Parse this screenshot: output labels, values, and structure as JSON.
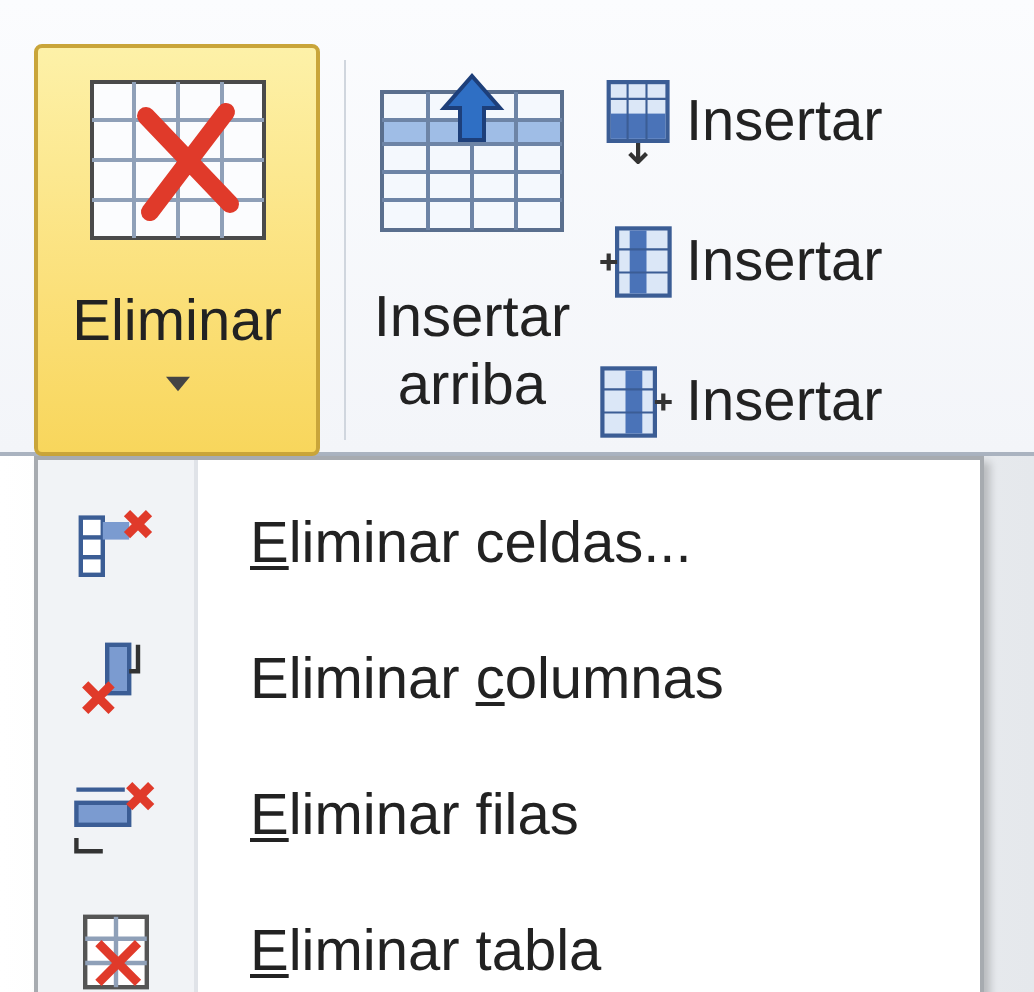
{
  "ribbon": {
    "delete_button": {
      "label": "Eliminar",
      "highlighted": true
    },
    "insert_above_button": {
      "label_lines": [
        "Insertar",
        "arriba"
      ]
    },
    "small_buttons": [
      {
        "kind": "below",
        "label": "Insertar"
      },
      {
        "kind": "left",
        "label": "Insertar"
      },
      {
        "kind": "right",
        "label": "Insertar"
      }
    ]
  },
  "menu": {
    "items": [
      {
        "kind": "cells",
        "label_key": "E",
        "label_after": "liminar celdas..."
      },
      {
        "kind": "columns",
        "label_before": "Eliminar ",
        "label_key": "c",
        "label_after": "olumnas"
      },
      {
        "kind": "rows",
        "label_key": "E",
        "label_after": "liminar filas"
      },
      {
        "kind": "table",
        "label_key": "E",
        "label_after": "liminar tabla"
      }
    ]
  }
}
